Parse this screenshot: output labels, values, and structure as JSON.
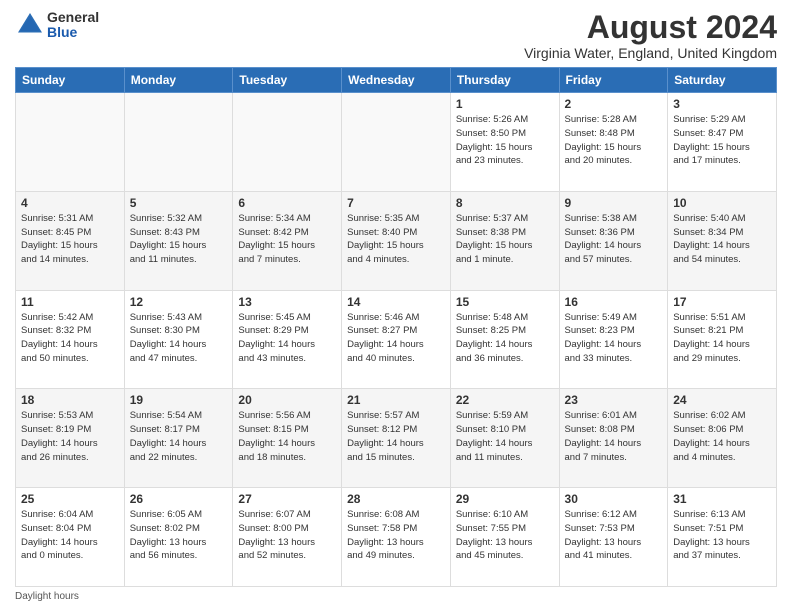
{
  "logo": {
    "general": "General",
    "blue": "Blue"
  },
  "title": "August 2024",
  "location": "Virginia Water, England, United Kingdom",
  "days_of_week": [
    "Sunday",
    "Monday",
    "Tuesday",
    "Wednesday",
    "Thursday",
    "Friday",
    "Saturday"
  ],
  "footer": "Daylight hours",
  "weeks": [
    [
      {
        "day": "",
        "info": ""
      },
      {
        "day": "",
        "info": ""
      },
      {
        "day": "",
        "info": ""
      },
      {
        "day": "",
        "info": ""
      },
      {
        "day": "1",
        "info": "Sunrise: 5:26 AM\nSunset: 8:50 PM\nDaylight: 15 hours\nand 23 minutes."
      },
      {
        "day": "2",
        "info": "Sunrise: 5:28 AM\nSunset: 8:48 PM\nDaylight: 15 hours\nand 20 minutes."
      },
      {
        "day": "3",
        "info": "Sunrise: 5:29 AM\nSunset: 8:47 PM\nDaylight: 15 hours\nand 17 minutes."
      }
    ],
    [
      {
        "day": "4",
        "info": "Sunrise: 5:31 AM\nSunset: 8:45 PM\nDaylight: 15 hours\nand 14 minutes."
      },
      {
        "day": "5",
        "info": "Sunrise: 5:32 AM\nSunset: 8:43 PM\nDaylight: 15 hours\nand 11 minutes."
      },
      {
        "day": "6",
        "info": "Sunrise: 5:34 AM\nSunset: 8:42 PM\nDaylight: 15 hours\nand 7 minutes."
      },
      {
        "day": "7",
        "info": "Sunrise: 5:35 AM\nSunset: 8:40 PM\nDaylight: 15 hours\nand 4 minutes."
      },
      {
        "day": "8",
        "info": "Sunrise: 5:37 AM\nSunset: 8:38 PM\nDaylight: 15 hours\nand 1 minute."
      },
      {
        "day": "9",
        "info": "Sunrise: 5:38 AM\nSunset: 8:36 PM\nDaylight: 14 hours\nand 57 minutes."
      },
      {
        "day": "10",
        "info": "Sunrise: 5:40 AM\nSunset: 8:34 PM\nDaylight: 14 hours\nand 54 minutes."
      }
    ],
    [
      {
        "day": "11",
        "info": "Sunrise: 5:42 AM\nSunset: 8:32 PM\nDaylight: 14 hours\nand 50 minutes."
      },
      {
        "day": "12",
        "info": "Sunrise: 5:43 AM\nSunset: 8:30 PM\nDaylight: 14 hours\nand 47 minutes."
      },
      {
        "day": "13",
        "info": "Sunrise: 5:45 AM\nSunset: 8:29 PM\nDaylight: 14 hours\nand 43 minutes."
      },
      {
        "day": "14",
        "info": "Sunrise: 5:46 AM\nSunset: 8:27 PM\nDaylight: 14 hours\nand 40 minutes."
      },
      {
        "day": "15",
        "info": "Sunrise: 5:48 AM\nSunset: 8:25 PM\nDaylight: 14 hours\nand 36 minutes."
      },
      {
        "day": "16",
        "info": "Sunrise: 5:49 AM\nSunset: 8:23 PM\nDaylight: 14 hours\nand 33 minutes."
      },
      {
        "day": "17",
        "info": "Sunrise: 5:51 AM\nSunset: 8:21 PM\nDaylight: 14 hours\nand 29 minutes."
      }
    ],
    [
      {
        "day": "18",
        "info": "Sunrise: 5:53 AM\nSunset: 8:19 PM\nDaylight: 14 hours\nand 26 minutes."
      },
      {
        "day": "19",
        "info": "Sunrise: 5:54 AM\nSunset: 8:17 PM\nDaylight: 14 hours\nand 22 minutes."
      },
      {
        "day": "20",
        "info": "Sunrise: 5:56 AM\nSunset: 8:15 PM\nDaylight: 14 hours\nand 18 minutes."
      },
      {
        "day": "21",
        "info": "Sunrise: 5:57 AM\nSunset: 8:12 PM\nDaylight: 14 hours\nand 15 minutes."
      },
      {
        "day": "22",
        "info": "Sunrise: 5:59 AM\nSunset: 8:10 PM\nDaylight: 14 hours\nand 11 minutes."
      },
      {
        "day": "23",
        "info": "Sunrise: 6:01 AM\nSunset: 8:08 PM\nDaylight: 14 hours\nand 7 minutes."
      },
      {
        "day": "24",
        "info": "Sunrise: 6:02 AM\nSunset: 8:06 PM\nDaylight: 14 hours\nand 4 minutes."
      }
    ],
    [
      {
        "day": "25",
        "info": "Sunrise: 6:04 AM\nSunset: 8:04 PM\nDaylight: 14 hours\nand 0 minutes."
      },
      {
        "day": "26",
        "info": "Sunrise: 6:05 AM\nSunset: 8:02 PM\nDaylight: 13 hours\nand 56 minutes."
      },
      {
        "day": "27",
        "info": "Sunrise: 6:07 AM\nSunset: 8:00 PM\nDaylight: 13 hours\nand 52 minutes."
      },
      {
        "day": "28",
        "info": "Sunrise: 6:08 AM\nSunset: 7:58 PM\nDaylight: 13 hours\nand 49 minutes."
      },
      {
        "day": "29",
        "info": "Sunrise: 6:10 AM\nSunset: 7:55 PM\nDaylight: 13 hours\nand 45 minutes."
      },
      {
        "day": "30",
        "info": "Sunrise: 6:12 AM\nSunset: 7:53 PM\nDaylight: 13 hours\nand 41 minutes."
      },
      {
        "day": "31",
        "info": "Sunrise: 6:13 AM\nSunset: 7:51 PM\nDaylight: 13 hours\nand 37 minutes."
      }
    ]
  ]
}
